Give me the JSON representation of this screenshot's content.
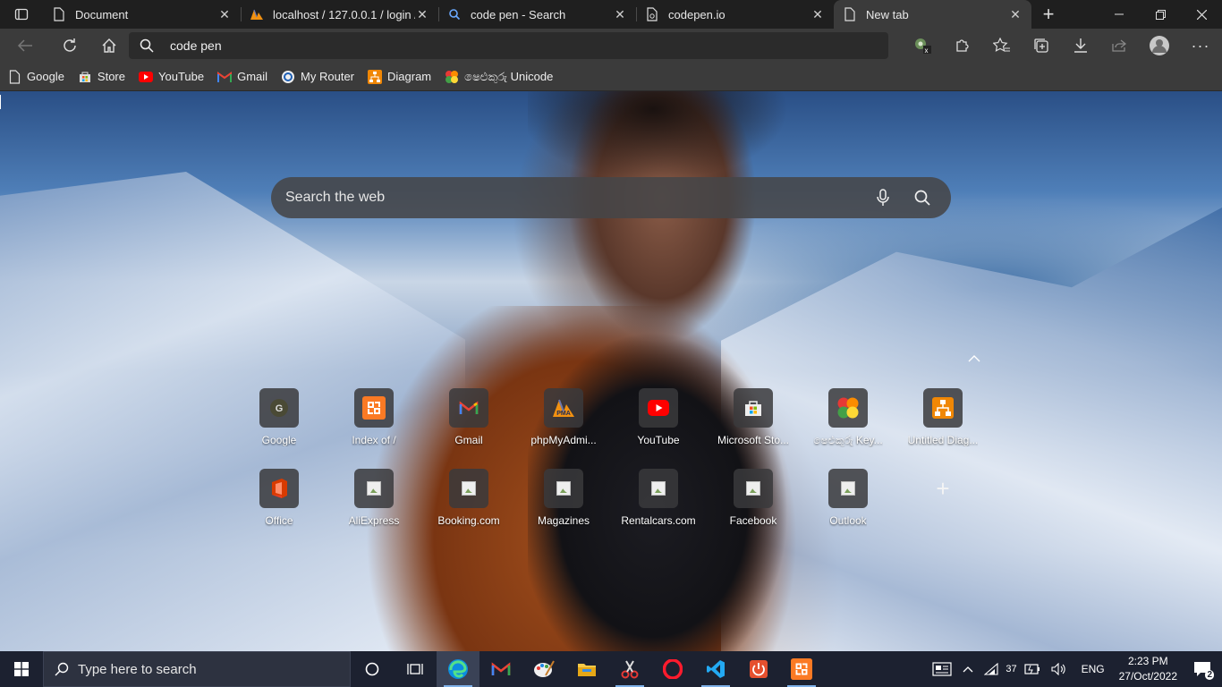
{
  "colors": {
    "tab_bg": "#1f1f1f",
    "toolbar_bg": "#3b3b3b",
    "taskbar_bg": "#1c2130",
    "accent": "#7fb1e8"
  },
  "tabs": [
    {
      "title": "Document",
      "icon": "page-icon",
      "active": false
    },
    {
      "title": "localhost / 127.0.0.1 / login /",
      "icon": "phpmyadmin-icon",
      "active": false
    },
    {
      "title": "code pen - Search",
      "icon": "search-icon",
      "active": false
    },
    {
      "title": "codepen.io",
      "icon": "page-broken-icon",
      "active": false
    },
    {
      "title": "New tab",
      "icon": "page-icon",
      "active": true
    }
  ],
  "address_bar": {
    "value": "code pen"
  },
  "favorites": [
    {
      "label": "Google",
      "icon": "page-icon"
    },
    {
      "label": "Store",
      "icon": "store-icon"
    },
    {
      "label": "YouTube",
      "icon": "youtube-icon"
    },
    {
      "label": "Gmail",
      "icon": "gmail-icon"
    },
    {
      "label": "My Router",
      "icon": "router-icon"
    },
    {
      "label": "Diagram",
      "icon": "diagram-icon"
    },
    {
      "label": "ෂෙළුකුරු Unicode",
      "icon": "unicode-icon"
    }
  ],
  "search": {
    "placeholder": "Search the web"
  },
  "quick_links": [
    {
      "label": "Google",
      "icon": "google-icon"
    },
    {
      "label": "Index of /",
      "icon": "xampp-icon"
    },
    {
      "label": "Gmail",
      "icon": "gmail-icon"
    },
    {
      "label": "phpMyAdmi...",
      "icon": "phpmyadmin-icon"
    },
    {
      "label": "YouTube",
      "icon": "youtube-icon"
    },
    {
      "label": "Microsoft Sto...",
      "icon": "store-icon"
    },
    {
      "label": "ෂෙළුකුරු Key...",
      "icon": "unicode-icon"
    },
    {
      "label": "Untitled Diag...",
      "icon": "diagram-icon"
    },
    {
      "label": "Office",
      "icon": "office-icon"
    },
    {
      "label": "AliExpress",
      "icon": "broken-image-icon"
    },
    {
      "label": "Booking.com",
      "icon": "broken-image-icon"
    },
    {
      "label": "Magazines",
      "icon": "broken-image-icon"
    },
    {
      "label": "Rentalcars.com",
      "icon": "broken-image-icon"
    },
    {
      "label": "Facebook",
      "icon": "broken-image-icon"
    },
    {
      "label": "Outlook",
      "icon": "broken-image-icon"
    }
  ],
  "taskbar": {
    "search_placeholder": "Type here to search",
    "apps": [
      "task-view-icon",
      "edge-icon",
      "gmail-icon",
      "paint-icon",
      "file-explorer-icon",
      "snip-icon",
      "opera-icon",
      "vscode-icon",
      "power-icon",
      "xampp-icon"
    ],
    "tray": {
      "temperature": "37",
      "language": "ENG",
      "time": "2:23 PM",
      "date": "27/Oct/2022",
      "notifications": "2"
    }
  }
}
